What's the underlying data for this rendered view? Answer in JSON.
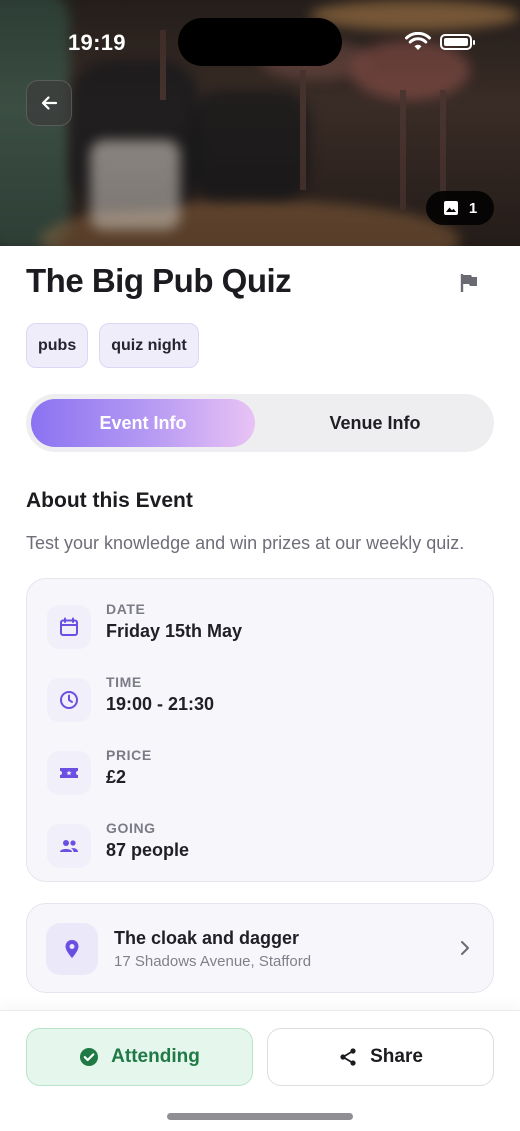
{
  "status_bar": {
    "time": "19:19"
  },
  "hero": {
    "photo_count": "1"
  },
  "event": {
    "title": "The Big Pub Quiz",
    "tags": [
      "pubs",
      "quiz night"
    ]
  },
  "tabs": {
    "active": "Event Info",
    "inactive": "Venue Info"
  },
  "about": {
    "heading": "About this Event",
    "description": "Test your knowledge and win prizes at our weekly quiz."
  },
  "details": [
    {
      "label": "DATE",
      "value": "Friday 15th May",
      "icon": "calendar-icon"
    },
    {
      "label": "TIME",
      "value": "19:00 - 21:30",
      "icon": "clock-icon"
    },
    {
      "label": "PRICE",
      "value": "£2",
      "icon": "ticket-icon"
    },
    {
      "label": "GOING",
      "value": "87 people",
      "icon": "people-icon"
    }
  ],
  "venue": {
    "name": "The cloak and dagger",
    "address": "17 Shadows Avenue, Stafford"
  },
  "actions": {
    "attending_label": "Attending",
    "share_label": "Share"
  },
  "colors": {
    "accent": "#6b4fe0",
    "attending_green": "#1f7a45"
  }
}
